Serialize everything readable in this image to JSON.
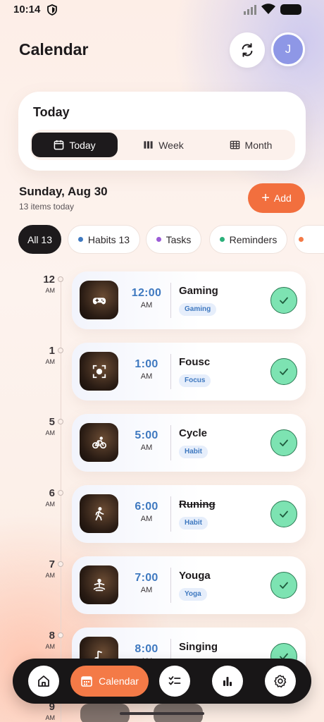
{
  "status_bar": {
    "time": "10:14"
  },
  "header": {
    "title": "Calendar",
    "avatar_initial": "J"
  },
  "view_card": {
    "title": "Today",
    "options": [
      {
        "label": "Today",
        "icon": "calendar-icon",
        "active": true
      },
      {
        "label": "Week",
        "icon": "columns-icon",
        "active": false
      },
      {
        "label": "Month",
        "icon": "grid-icon",
        "active": false
      }
    ]
  },
  "date_section": {
    "date": "Sunday, Aug 30",
    "subtitle": "13 items today",
    "add_label": "Add"
  },
  "filters": [
    {
      "label": "All 13",
      "active": true
    },
    {
      "label": "Habits 13",
      "dot_color": "#3f79c0"
    },
    {
      "label": "Tasks",
      "dot_color": "#9b5cd6"
    },
    {
      "label": "Reminders",
      "dot_color": "#2bb07a"
    }
  ],
  "events": [
    {
      "hour": "12",
      "period": "AM",
      "time": "12:00",
      "time_period": "AM",
      "title": "Gaming",
      "tag": "Gaming",
      "icon": "gamepad-icon",
      "done": true
    },
    {
      "hour": "1",
      "period": "AM",
      "time": "1:00",
      "time_period": "AM",
      "title": "Fousc",
      "tag": "Focus",
      "icon": "focus-icon",
      "done": true
    },
    {
      "hour": "5",
      "period": "AM",
      "time": "5:00",
      "time_period": "AM",
      "title": "Cycle",
      "tag": "Habit",
      "icon": "bicycle-icon",
      "done": true
    },
    {
      "hour": "6",
      "period": "AM",
      "time": "6:00",
      "time_period": "AM",
      "title": "Runing",
      "tag": "Habit",
      "icon": "walking-icon",
      "done": true,
      "struck": true
    },
    {
      "hour": "7",
      "period": "AM",
      "time": "7:00",
      "time_period": "AM",
      "title": "Youga",
      "tag": "Yoga",
      "icon": "yoga-icon",
      "done": true
    },
    {
      "hour": "8",
      "period": "AM",
      "time": "8:00",
      "time_period": "AM",
      "title": "Singing",
      "tag": "",
      "icon": "music-icon",
      "done": true
    }
  ],
  "next_hour": {
    "hour": "9",
    "period": "AM"
  },
  "bottom_nav": {
    "active_label": "Calendar"
  }
}
